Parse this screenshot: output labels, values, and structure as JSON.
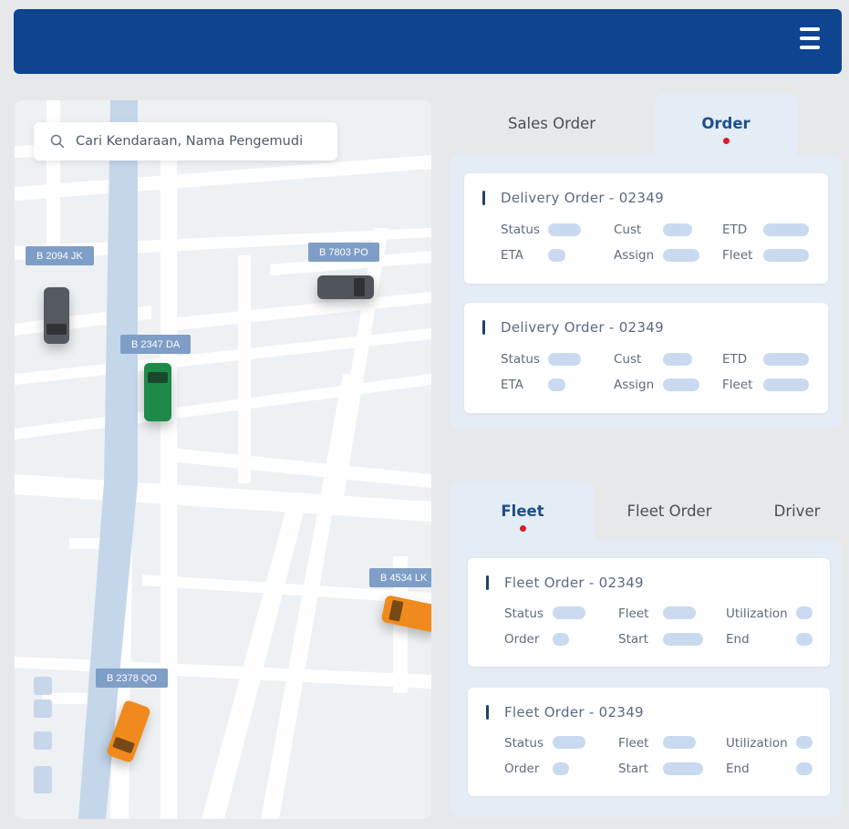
{
  "header": {
    "menu_icon": "hamburger-menu-icon"
  },
  "map": {
    "search_placeholder": "Cari Kendaraan, Nama Pengemudi",
    "search_icon": "search-icon",
    "vehicles": [
      {
        "plate": "B 2094 JK",
        "color": "#555a60"
      },
      {
        "plate": "B 7803 PO",
        "color": "#50555b"
      },
      {
        "plate": "B 2347 DA",
        "color": "#1e8a4a"
      },
      {
        "plate": "B 4534 LK",
        "color": "#f08a1c"
      },
      {
        "plate": "B 2378 QO",
        "color": "#f08a1c"
      }
    ]
  },
  "orders": {
    "tabs": [
      {
        "label": "Sales Order",
        "active": false
      },
      {
        "label": "Order",
        "active": true
      }
    ],
    "cards": [
      {
        "title": "Delivery Order - 02349",
        "fields": [
          "Status",
          "Cust",
          "ETD",
          "ETA",
          "Assign",
          "Fleet"
        ]
      },
      {
        "title": "Delivery Order - 02349",
        "fields": [
          "Status",
          "Cust",
          "ETD",
          "ETA",
          "Assign",
          "Fleet"
        ]
      }
    ]
  },
  "fleet": {
    "tabs": [
      {
        "label": "Fleet",
        "active": true
      },
      {
        "label": "Fleet Order",
        "active": false
      },
      {
        "label": "Driver",
        "active": false
      }
    ],
    "cards": [
      {
        "title": "Fleet Order - 02349",
        "fields": [
          "Status",
          "Fleet",
          "Utilization",
          "Order",
          "Start",
          "End"
        ]
      },
      {
        "title": "Fleet Order - 02349",
        "fields": [
          "Status",
          "Fleet",
          "Utilization",
          "Order",
          "Start",
          "End"
        ]
      }
    ]
  },
  "colors": {
    "header": "#0e4490",
    "accent": "#1d4f8c",
    "dot": "#d81e2a",
    "plate": "#7e9ec7",
    "river": "#c4d6ea"
  }
}
